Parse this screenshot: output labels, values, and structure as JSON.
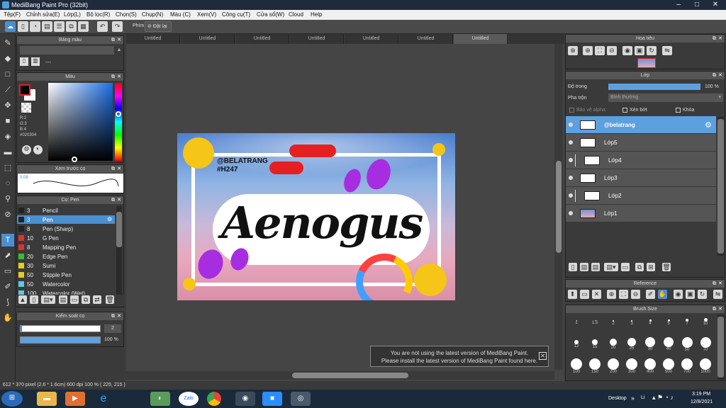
{
  "window": {
    "title": "MediBang Paint Pro (32bit)"
  },
  "menu": [
    "Tệp(F)",
    "Chỉnh sửa(E)",
    "Lớp(L)",
    "Bộ lọc(R)",
    "Chọn(S)",
    "Chụp(N)",
    "Màu (C)",
    "Xem(V)",
    "Công cụ(T)",
    "Cửa sổ(W)",
    "Cloud",
    "Help"
  ],
  "toolbar": {
    "shortcut_label": "Phím",
    "reset_label": "Đặt lại"
  },
  "tabs": [
    "Untitled",
    "Untitled",
    "Untitled",
    "Untitled",
    "Untitled",
    "Untitled",
    "Untitled"
  ],
  "palette_panel": {
    "title": "Bảng màu",
    "dash": "---"
  },
  "color_panel": {
    "title": "Màu",
    "r": "R:2",
    "g": "G:3",
    "b": "B:4",
    "hex": "#020304",
    "fg_color": "#020304"
  },
  "preview_panel": {
    "title": "Xem trước cọ",
    "size": "0.08"
  },
  "brush_panel": {
    "title": "Cọ: Pen",
    "brushes": [
      {
        "size": "3",
        "name": "Pencil",
        "color": "#222222"
      },
      {
        "size": "3",
        "name": "Pen",
        "color": "#222222"
      },
      {
        "size": "8",
        "name": "Pen (Sharp)",
        "color": "#222222"
      },
      {
        "size": "10",
        "name": "G Pen",
        "color": "#e03030"
      },
      {
        "size": "8",
        "name": "Mapping Pen",
        "color": "#e03030"
      },
      {
        "size": "20",
        "name": "Edge Pen",
        "color": "#30c030"
      },
      {
        "size": "30",
        "name": "Sumi",
        "color": "#e0d020"
      },
      {
        "size": "50",
        "name": "Stipple Pen",
        "color": "#e0d020"
      },
      {
        "size": "50",
        "name": "Watercolor",
        "color": "#60c8e0"
      },
      {
        "size": "100",
        "name": "Watercolor (Wet)",
        "color": "#60c8e0"
      }
    ]
  },
  "control_panel": {
    "title": "Kiểm soát cọ",
    "size": "2",
    "opacity": "100 %"
  },
  "navigator": {
    "title": "Hoa tiêu"
  },
  "layer_panel": {
    "title": "Lớp",
    "opacity_label": "Độ trong",
    "opacity_value": "100 %",
    "blend_label": "Pha trộn",
    "blend_value": "Bình thường",
    "protect_alpha": "Bảo vệ alpha",
    "clip": "Xén bớt",
    "lock": "Khóa",
    "layers": [
      {
        "name": "@belatrang",
        "indent": false
      },
      {
        "name": "Lớp5",
        "indent": false
      },
      {
        "name": "Lớp4",
        "indent": true
      },
      {
        "name": "Lớp3",
        "indent": false
      },
      {
        "name": "Lớp2",
        "indent": true
      },
      {
        "name": "Lớp1",
        "indent": false
      }
    ]
  },
  "reference": {
    "title": "Reference"
  },
  "brush_size": {
    "title": "Brush Size",
    "sizes": [
      "1",
      "1.5",
      "2",
      "3",
      "4",
      "5",
      "7",
      "10",
      "12",
      "15",
      "20",
      "25",
      "30",
      "40",
      "50",
      "70",
      "100",
      "150",
      "200",
      "300",
      "400",
      "500",
      "700",
      "1000"
    ]
  },
  "artwork": {
    "handle": "@BELATRANG",
    "tag": "#H247",
    "word": "Aenogus"
  },
  "update_notice": {
    "line1": "You are not using the latest version of MediBang Paint.",
    "line2": "Please install the latest version of MediBang Paint found here."
  },
  "status": {
    "text": "612 * 370 pixel   (2.6 * 1.6cm)   600 dpi   100 %   ( 225, 215 )"
  },
  "taskbar": {
    "desktop": "Desktop",
    "lang": "Li",
    "time": "3:19 PM",
    "date": "12/8/2021",
    "zalo": "Zalo"
  }
}
